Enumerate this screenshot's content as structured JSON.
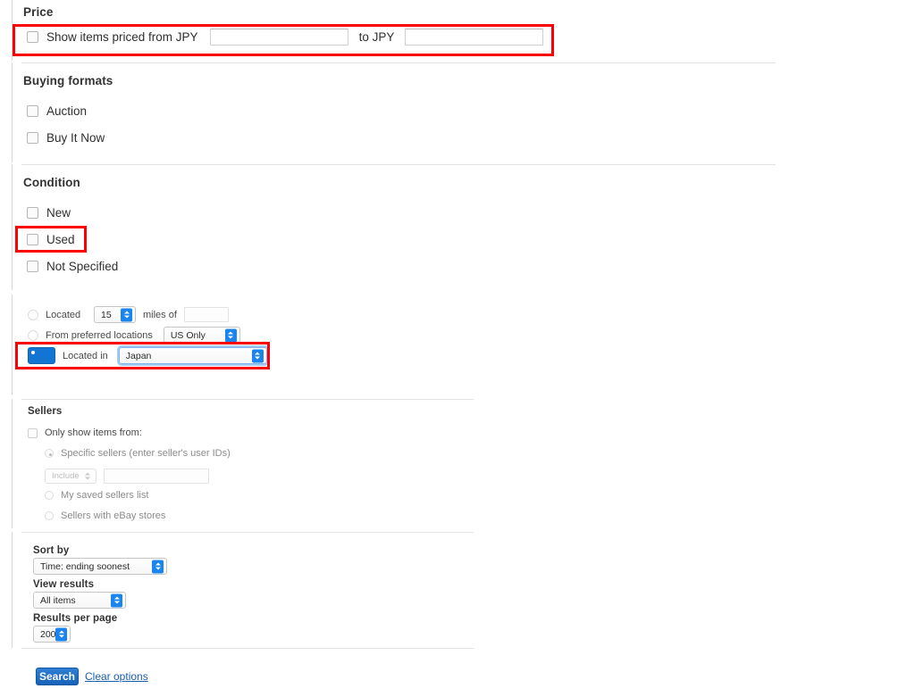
{
  "sections": {
    "price": {
      "title": "Price",
      "checkbox_label": "Show items priced from JPY",
      "to_label": "to JPY",
      "min_value": "",
      "max_value": ""
    },
    "buying_formats": {
      "title": "Buying formats",
      "options": [
        {
          "label": "Auction",
          "checked": false
        },
        {
          "label": "Buy It Now",
          "checked": false
        }
      ]
    },
    "condition": {
      "title": "Condition",
      "options": [
        {
          "label": "New",
          "checked": false
        },
        {
          "label": "Used",
          "checked": false
        },
        {
          "label": "Not Specified",
          "checked": false
        }
      ]
    },
    "location": {
      "located_label": "Located",
      "miles_value": "15",
      "miles_of_label": "miles of",
      "zip_value": "",
      "preferred_label": "From preferred locations",
      "preferred_value": "US Only",
      "located_in_label": "Located in",
      "located_in_value": "Japan"
    },
    "sellers": {
      "title": "Sellers",
      "only_show_label": "Only show items from:",
      "specific_label": "Specific sellers (enter seller's user IDs)",
      "include_value": "Include",
      "seller_ids_value": "",
      "saved_list_label": "My saved sellers list",
      "stores_label": "Sellers with eBay stores"
    },
    "sort": {
      "sort_by_title": "Sort by",
      "sort_by_value": "Time: ending soonest",
      "view_results_title": "View results",
      "view_results_value": "All items",
      "results_per_page_title": "Results per page",
      "results_per_page_value": "200"
    },
    "actions": {
      "search_label": "Search",
      "clear_label": "Clear options"
    }
  },
  "annotations": {
    "highlight_color": "#fb0007",
    "boxes": [
      {
        "name": "price-row-highlight"
      },
      {
        "name": "used-condition-highlight"
      },
      {
        "name": "located-in-highlight"
      }
    ]
  }
}
